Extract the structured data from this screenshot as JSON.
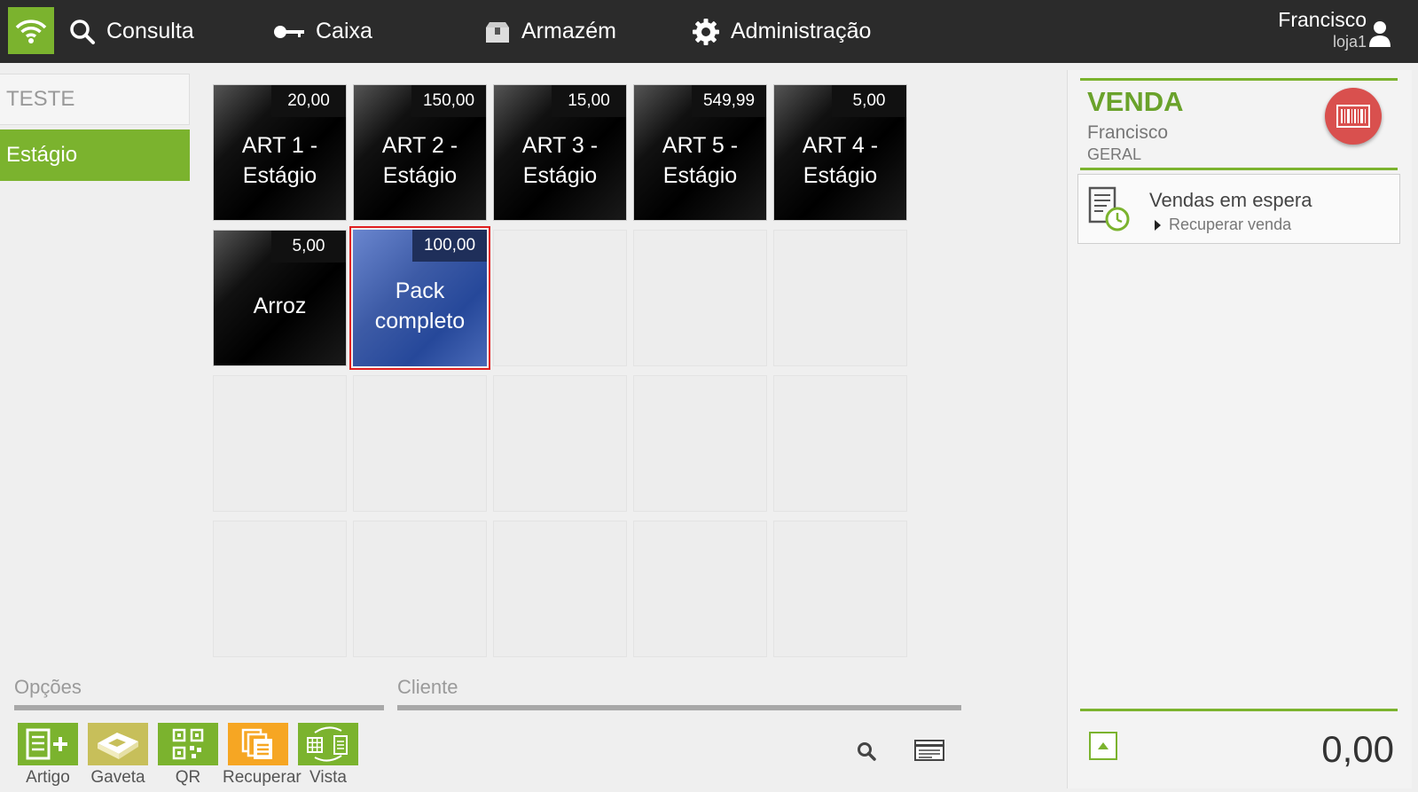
{
  "topbar": {
    "nav": [
      {
        "label": "Consulta",
        "icon": "search-icon"
      },
      {
        "label": "Caixa",
        "icon": "key-icon"
      },
      {
        "label": "Armazém",
        "icon": "box-icon"
      },
      {
        "label": "Administração",
        "icon": "gear-icon"
      }
    ],
    "user": {
      "name": "Francisco",
      "store": "loja1"
    }
  },
  "categories": [
    {
      "label": "TESTE",
      "selected": false
    },
    {
      "label": "Estágio",
      "selected": true
    }
  ],
  "tiles": [
    {
      "name": "ART 1 - Estágio",
      "price": "20,00"
    },
    {
      "name": "ART 2 - Estágio",
      "price": "150,00"
    },
    {
      "name": "ART 3 - Estágio",
      "price": "15,00"
    },
    {
      "name": "ART 5 - Estágio",
      "price": "549,99"
    },
    {
      "name": "ART 4 - Estágio",
      "price": "5,00"
    },
    {
      "name": "Arroz",
      "price": "5,00"
    },
    {
      "name": "Pack completo",
      "price": "100,00",
      "selected": true
    }
  ],
  "options": {
    "label": "Opções",
    "buttons": [
      {
        "label": "Artigo",
        "color": "#7bb32e"
      },
      {
        "label": "Gaveta",
        "color": "#c7bf5a"
      },
      {
        "label": "QR",
        "color": "#7bb32e"
      },
      {
        "label": "Recuperar",
        "color": "#f6a623"
      },
      {
        "label": "Vista",
        "color": "#7bb32e"
      }
    ]
  },
  "client": {
    "label": "Cliente"
  },
  "sale": {
    "title": "VENDA",
    "user": "Francisco",
    "group": "GERAL",
    "waiting_title": "Vendas em espera",
    "waiting_action": "Recuperar venda",
    "total": "0,00"
  },
  "colors": {
    "accent": "#7bb32e",
    "topbar": "#2b2b2b",
    "selected_outline": "#e02020",
    "barcode": "#d9504e"
  }
}
